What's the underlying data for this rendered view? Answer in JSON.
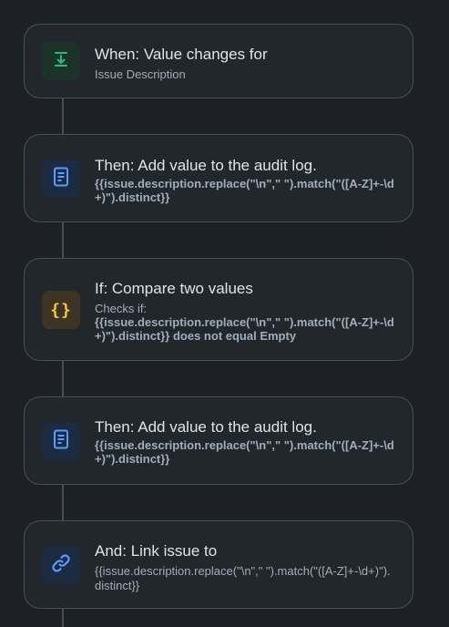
{
  "flow": {
    "trigger": {
      "title": "When: Value changes for",
      "subtitle": "Issue Description",
      "icon": "download-icon",
      "color": "#2abb7f"
    },
    "step1": {
      "title": "Then: Add value to the audit log.",
      "detail": "{{issue.description.replace(\"\\n\",\" \").match(\"([A-Z]+-\\d+)\").distinct}}",
      "icon": "document-icon",
      "color": "#579dff"
    },
    "condition": {
      "title": "If: Compare two values",
      "checks_label": "Checks if:",
      "detail": "{{issue.description.replace(\"\\n\",\" \").match(\"([A-Z]+-\\d+)\").distinct}} does not equal Empty",
      "icon": "braces-icon",
      "icon_text": "{}",
      "color": "#f8c641"
    },
    "step2": {
      "title": "Then: Add value to the audit log.",
      "detail": "{{issue.description.replace(\"\\n\",\" \").match(\"([A-Z]+-\\d+)\").distinct}}",
      "icon": "document-icon",
      "color": "#579dff"
    },
    "step3": {
      "title": "And: Link issue to",
      "detail": "{{issue.description.replace(\"\\n\",\" \").match(\"([A-Z]+-\\d+)\").distinct}}",
      "icon": "link-icon",
      "color": "#579dff"
    }
  }
}
